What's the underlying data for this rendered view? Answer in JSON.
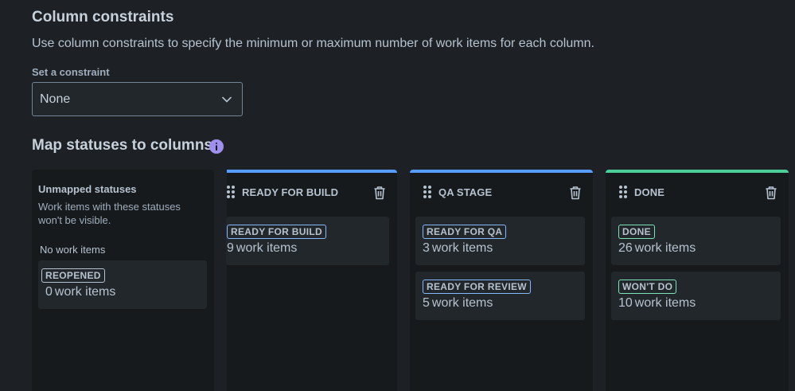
{
  "constraints": {
    "title": "Column constraints",
    "description": "Use column constraints to specify the minimum or maximum number of work items for each column.",
    "field_label": "Set a constraint",
    "selected_value": "None"
  },
  "mapping": {
    "title": "Map statuses to columns"
  },
  "unmapped": {
    "title": "Unmapped statuses",
    "description": "Work items with these statuses won't be visible.",
    "empty_text": "No work items",
    "cards": [
      {
        "status": "REOPENED",
        "count": "0",
        "suffix": "work items"
      }
    ]
  },
  "columns": [
    {
      "name": "READY FOR BUILD",
      "bar_color": "#579dff",
      "cards": [
        {
          "status": "READY FOR BUILD",
          "count": "9",
          "suffix": "work items"
        }
      ]
    },
    {
      "name": "QA STAGE",
      "bar_color": "#579dff",
      "cards": [
        {
          "status": "READY FOR QA",
          "count": "3",
          "suffix": "work items"
        },
        {
          "status": "READY FOR REVIEW",
          "count": "5",
          "suffix": "work items"
        }
      ]
    },
    {
      "name": "DONE",
      "bar_color": "#4bce97",
      "cards": [
        {
          "status": "DONE",
          "count": "26",
          "suffix": "work items"
        },
        {
          "status": "WON'T DO",
          "count": "10",
          "suffix": "work items"
        }
      ]
    }
  ],
  "icons": {
    "info": "info-icon",
    "chevron": "chevron-down-icon",
    "trash": "trash-icon",
    "drag": "drag-handle-icon"
  },
  "colors": {
    "background": "#1d2125",
    "column_bg": "#161a1d",
    "card_bg": "#22272b",
    "accent_blue": "#579dff",
    "accent_green": "#4bce97",
    "info_purple": "#9f8fef"
  }
}
